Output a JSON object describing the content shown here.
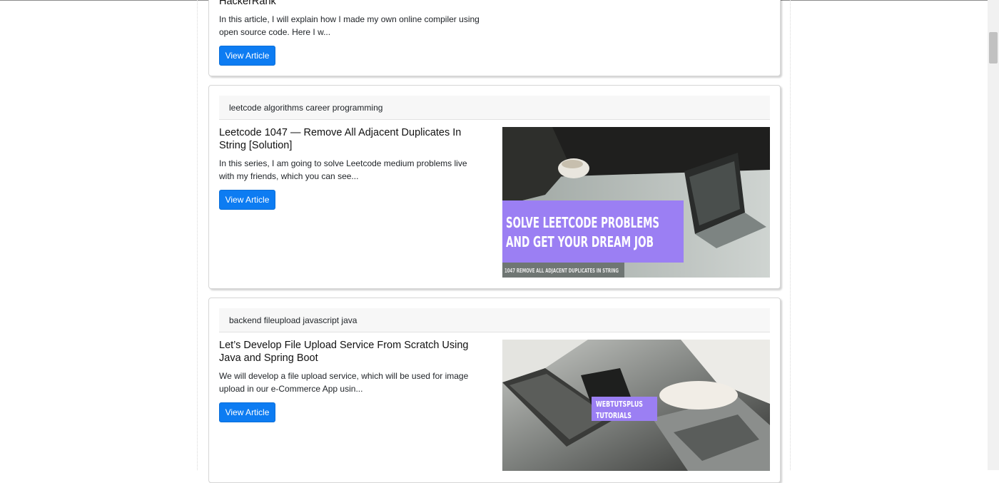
{
  "articles": [
    {
      "title": "HackerRank",
      "excerpt": "In this article, I will explain how I made my own online compiler using open source code. Here I w...",
      "button_label": "View Article"
    },
    {
      "tags": "leetcode algorithms career programming",
      "title": "Leetcode 1047 — Remove All Adjacent Duplicates In String [Solution]",
      "excerpt": "In this series, I am going to solve Leetcode medium problems live with my friends, which you can see...",
      "button_label": "View Article",
      "image": {
        "headline_line1": "SOLVE LEETCODE PROBLEMS",
        "headline_line2": "AND GET YOUR DREAM JOB",
        "caption": "1047 REMOVE ALL ADJACENT DUPLICATES IN STRING"
      }
    },
    {
      "tags": "backend fileupload javascript java",
      "title": "Let’s Develop File Upload Service From Scratch Using Java and Spring Boot",
      "excerpt": "We will develop a file upload service, which will be used for image upload in our e-Commerce App usin...",
      "button_label": "View Article",
      "image": {
        "label_line1": "WEBTUTSPLUS",
        "label_line2": "TUTORIALS"
      }
    }
  ],
  "colors": {
    "button": "#0d7cf2",
    "image_banner": "#9b7ff3"
  }
}
